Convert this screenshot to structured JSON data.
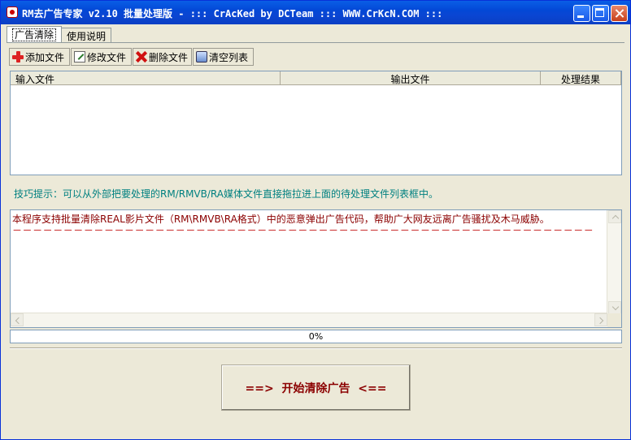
{
  "window": {
    "title": "RM去广告专家 v2.10 批量处理版 - ::: CrAcKed by DCTeam ::: WWW.CrKcN.COM :::"
  },
  "tabs": [
    {
      "label": "广告清除",
      "active": true
    },
    {
      "label": "使用说明",
      "active": false
    }
  ],
  "toolbar": {
    "add_label": "添加文件",
    "edit_label": "修改文件",
    "delete_label": "删除文件",
    "clear_label": "清空列表"
  },
  "file_list": {
    "columns": [
      "输入文件",
      "输出文件",
      "处理结果"
    ],
    "rows": []
  },
  "tip": "技巧提示：可以从外部把要处理的RM/RMVB/RA媒体文件直接拖拉进上面的待处理文件列表框中。",
  "info": {
    "line": "本程序支持批量清除REAL影片文件（RM\\RMVB\\RA格式）中的恶意弹出广告代码，帮助广大网友远离广告骚扰及木马威胁。",
    "divider": "－－－－－－－－－－－－－－－－－－－－－－－－－－－－－－－－－－－－－－－－－－－－－－－－－－－－－－－－－"
  },
  "progress": {
    "value": 0,
    "label": "0%"
  },
  "start_button": {
    "label": "==>  开始清除广告  <=="
  },
  "colors": {
    "title_bar": "#0a5ee6",
    "tip_text": "#008080",
    "info_text": "#8b0000",
    "start_text": "#8b0000"
  }
}
